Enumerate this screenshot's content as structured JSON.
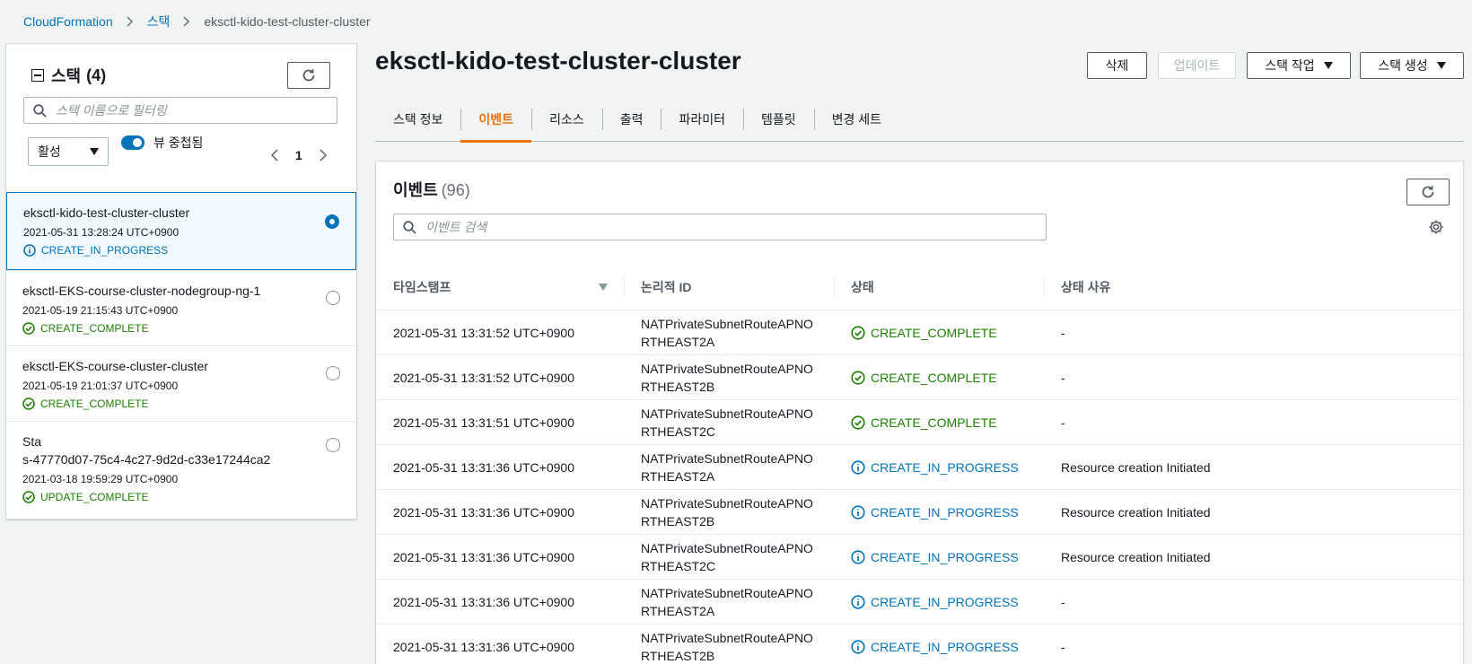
{
  "breadcrumb": {
    "items": [
      "CloudFormation",
      "스택",
      "eksctl-kido-test-cluster-cluster"
    ]
  },
  "sidebar": {
    "title": "스택",
    "count": "(4)",
    "search_placeholder": "스택 이름으로 필터링",
    "filter_select": "활성",
    "toggle_label": "뷰 중첩됨",
    "page": "1",
    "stacks": [
      {
        "name": "eksctl-kido-test-cluster-cluster",
        "time": "2021-05-31 13:28:24 UTC+0900",
        "status": "CREATE_IN_PROGRESS",
        "selected": true
      },
      {
        "name": "eksctl-EKS-course-cluster-nodegroup-ng-1",
        "time": "2021-05-19 21:15:43 UTC+0900",
        "status": "CREATE_COMPLETE",
        "selected": false
      },
      {
        "name": "eksctl-EKS-course-cluster-cluster",
        "time": "2021-05-19 21:01:37 UTC+0900",
        "status": "CREATE_COMPLETE",
        "selected": false
      },
      {
        "name_line1": "Sta",
        "name_line2": "s-47770d07-75c4-4c27-9d2d-c33e17244ca2",
        "time": "2021-03-18 19:59:29 UTC+0900",
        "status": "UPDATE_COMPLETE",
        "selected": false
      }
    ]
  },
  "main": {
    "title": "eksctl-kido-test-cluster-cluster",
    "buttons": {
      "delete": "삭제",
      "update": "업데이트",
      "stack_actions": "스택 작업",
      "create_stack": "스택 생성"
    },
    "tabs": [
      "스택 정보",
      "이벤트",
      "리소스",
      "출력",
      "파라미터",
      "템플릿",
      "변경 세트"
    ],
    "active_tab": "이벤트",
    "events": {
      "title": "이벤트",
      "count": "(96)",
      "search_placeholder": "이벤트 검색",
      "columns": [
        "타임스탬프",
        "논리적 ID",
        "상태",
        "상태 사유"
      ],
      "rows": [
        {
          "timestamp": "2021-05-31 13:31:52 UTC+0900",
          "logical_id": "NATPrivateSubnetRouteAPNORTHEAST2A",
          "status": "CREATE_COMPLETE",
          "reason": "-"
        },
        {
          "timestamp": "2021-05-31 13:31:52 UTC+0900",
          "logical_id": "NATPrivateSubnetRouteAPNORTHEAST2B",
          "status": "CREATE_COMPLETE",
          "reason": "-"
        },
        {
          "timestamp": "2021-05-31 13:31:51 UTC+0900",
          "logical_id": "NATPrivateSubnetRouteAPNORTHEAST2C",
          "status": "CREATE_COMPLETE",
          "reason": "-"
        },
        {
          "timestamp": "2021-05-31 13:31:36 UTC+0900",
          "logical_id": "NATPrivateSubnetRouteAPNORTHEAST2A",
          "status": "CREATE_IN_PROGRESS",
          "reason": "Resource creation Initiated"
        },
        {
          "timestamp": "2021-05-31 13:31:36 UTC+0900",
          "logical_id": "NATPrivateSubnetRouteAPNORTHEAST2B",
          "status": "CREATE_IN_PROGRESS",
          "reason": "Resource creation Initiated"
        },
        {
          "timestamp": "2021-05-31 13:31:36 UTC+0900",
          "logical_id": "NATPrivateSubnetRouteAPNORTHEAST2C",
          "status": "CREATE_IN_PROGRESS",
          "reason": "Resource creation Initiated"
        },
        {
          "timestamp": "2021-05-31 13:31:36 UTC+0900",
          "logical_id": "NATPrivateSubnetRouteAPNORTHEAST2A",
          "status": "CREATE_IN_PROGRESS",
          "reason": "-"
        },
        {
          "timestamp": "2021-05-31 13:31:36 UTC+0900",
          "logical_id": "NATPrivateSubnetRouteAPNORTHEAST2B",
          "status": "CREATE_IN_PROGRESS",
          "reason": "-"
        }
      ]
    }
  },
  "colors": {
    "link": "#0073bb",
    "success": "#1d8102",
    "accent_tab": "#ec7211"
  },
  "icons": {
    "success": "check-circle-icon",
    "info": "info-circle-icon",
    "refresh": "refresh-icon",
    "search": "search-icon",
    "settings": "gear-icon"
  }
}
